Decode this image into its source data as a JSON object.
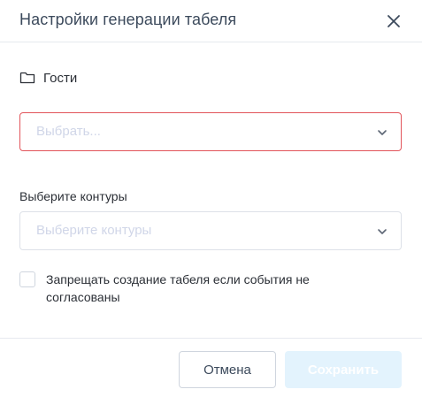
{
  "dialog": {
    "title": "Настройки генерации табеля"
  },
  "group": {
    "icon": "folder-icon",
    "label": "Гости"
  },
  "primary_select": {
    "placeholder": "Выбрать...",
    "state": "error",
    "border_color": "#e2545a"
  },
  "contours": {
    "label": "Выберите контуры",
    "placeholder": "Выберите контуры"
  },
  "checkbox": {
    "checked": false,
    "label": "Запрещать создание табеля если события не согласованы"
  },
  "footer": {
    "cancel_label": "Отмена",
    "save_label": "Сохранить",
    "save_enabled": false
  },
  "colors": {
    "error": "#e2545a",
    "placeholder": "#d0d6e8",
    "save_disabled_bg": "#e3f3fd",
    "title": "#3c4a5c"
  }
}
